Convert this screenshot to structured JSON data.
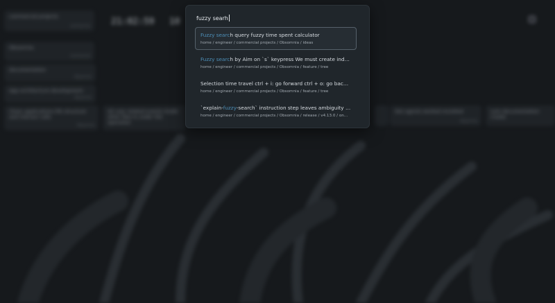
{
  "search": {
    "value": "fuzzy searh"
  },
  "results": [
    {
      "title_parts": [
        {
          "t": "Fuzzy searc",
          "hl": true
        },
        {
          "t": "h",
          "hl": false
        },
        {
          "t": " query fuzzy time spent calculator",
          "hl": false
        }
      ],
      "path": "home / engineer / commercial projects / Obsomnia / ideas",
      "selected": true
    },
    {
      "title_parts": [
        {
          "t": "Fuzzy searc",
          "hl": true
        },
        {
          "t": "h by Aim on `s` keypress We must create index on $t...",
          "hl": false
        }
      ],
      "path": "home / engineer / commercial projects / Obsomnia / feature / tree",
      "selected": false
    },
    {
      "title_parts": [
        {
          "t": "Selection time travel ctrl + i: go forward ctrl + o: go back Since ...",
          "hl": false
        }
      ],
      "path": "home / engineer / commercial projects / Obsomnia / feature / tree",
      "selected": false
    },
    {
      "title_parts": [
        {
          "t": "`explain-",
          "hl": false
        },
        {
          "t": "fuzzy",
          "hl": true
        },
        {
          "t": "-search` instruction step leaves ambiguity aboun...",
          "hl": false
        }
      ],
      "path": "home / engineer / commercial projects / Obsomnia / release / v4.13.0 / on...",
      "selected": false
    }
  ],
  "colors": {
    "highlight": "#4d8fb8",
    "background": "#16191c",
    "palette": "#20262b"
  },
  "background": {
    "clocks": [
      {
        "label": "",
        "value": "21:02:59"
      },
      {
        "label": "",
        "value": "10"
      }
    ]
  }
}
